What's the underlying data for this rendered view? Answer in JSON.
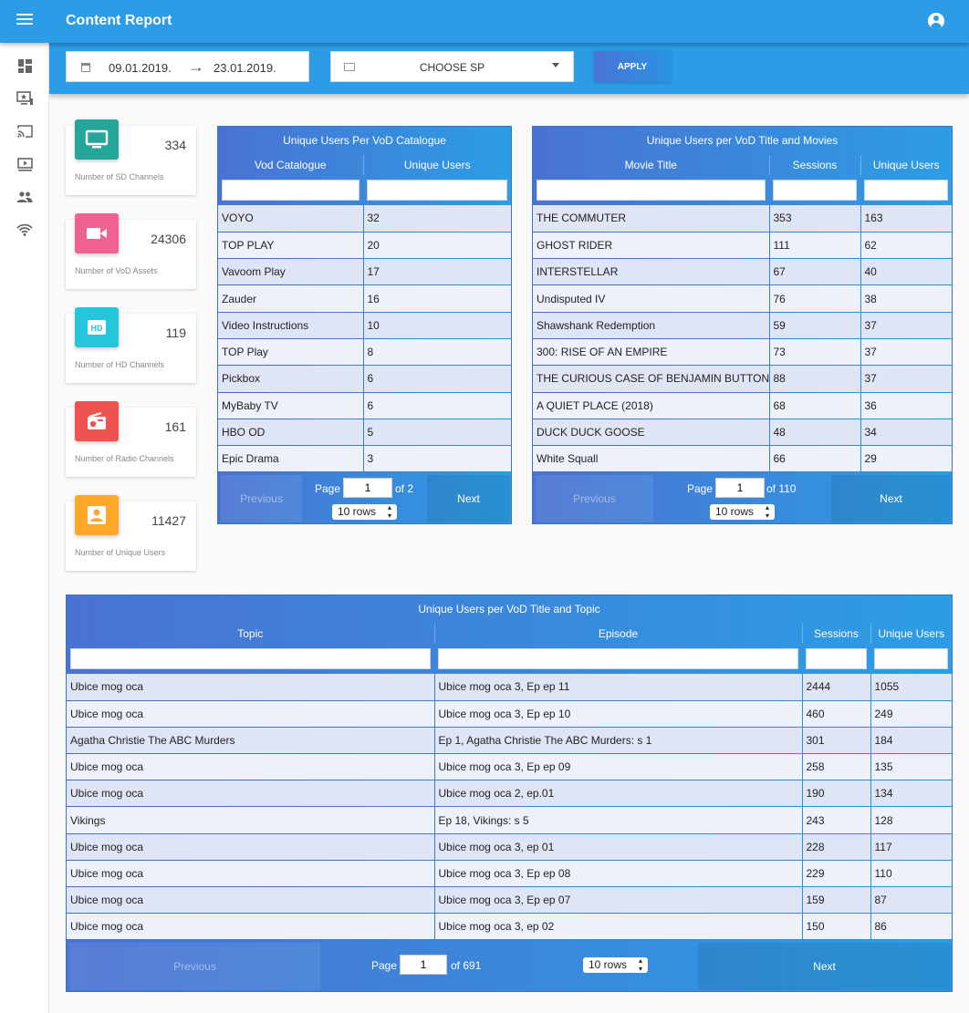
{
  "app": {
    "title": "Content Report"
  },
  "filters": {
    "date_start": "09.01.2019.",
    "date_end": "23.01.2019.",
    "arrow": "→",
    "sp_label": "CHOOSE SP",
    "apply_label": "APPLY"
  },
  "sidebar": {
    "items": [
      "dashboard-icon",
      "tv-star-icon",
      "cast-icon",
      "play-icon",
      "users-icon",
      "wifi-icon"
    ]
  },
  "stats": [
    {
      "value": "334",
      "label": "Number of SD Channels",
      "icon": "tv-icon",
      "color": "#26a69a"
    },
    {
      "value": "24306",
      "label": "Number of VoD Assets",
      "icon": "videocam-icon",
      "color": "#f06292"
    },
    {
      "value": "119",
      "label": "Number of HD Channels",
      "icon": "hd-icon",
      "color": "#26c6da"
    },
    {
      "value": "161",
      "label": "Number of Radio Channels",
      "icon": "radio-icon",
      "color": "#ef5350"
    },
    {
      "value": "11427",
      "label": "Number of Unique Users",
      "icon": "person-icon",
      "color": "#ffa726"
    }
  ],
  "catalogue": {
    "title": "Unique Users Per VoD Catalogue",
    "columns": [
      "Vod Catalogue",
      "Unique Users"
    ],
    "rows": [
      [
        "VOYO",
        "32"
      ],
      [
        "TOP PLAY",
        "20"
      ],
      [
        "Vavoom Play",
        "17"
      ],
      [
        "Zauder",
        "16"
      ],
      [
        "Video Instructions",
        "10"
      ],
      [
        "TOP Play",
        "8"
      ],
      [
        "Pickbox",
        "6"
      ],
      [
        "MyBaby TV",
        "6"
      ],
      [
        "HBO OD",
        "5"
      ],
      [
        "Epic Drama",
        "3"
      ]
    ],
    "pager": {
      "previous": "Previous",
      "next": "Next",
      "page_label": "Page",
      "page": "1",
      "of": "of 2",
      "rows": "10 rows"
    }
  },
  "movies": {
    "title": "Unique Users per VoD Title and Movies",
    "columns": [
      "Movie Title",
      "Sessions",
      "Unique Users"
    ],
    "rows": [
      [
        "THE COMMUTER",
        "353",
        "163"
      ],
      [
        "GHOST RIDER",
        "111",
        "62"
      ],
      [
        "INTERSTELLAR",
        "67",
        "40"
      ],
      [
        "Undisputed IV",
        "76",
        "38"
      ],
      [
        "Shawshank Redemption",
        "59",
        "37"
      ],
      [
        "300: RISE OF AN EMPIRE",
        "73",
        "37"
      ],
      [
        "THE CURIOUS CASE OF BENJAMIN BUTTON",
        "88",
        "37"
      ],
      [
        "A QUIET PLACE (2018)",
        "68",
        "36"
      ],
      [
        "DUCK DUCK GOOSE",
        "48",
        "34"
      ],
      [
        "White Squall",
        "66",
        "29"
      ]
    ],
    "pager": {
      "previous": "Previous",
      "next": "Next",
      "page_label": "Page",
      "page": "1",
      "of": "of 110",
      "rows": "10 rows"
    }
  },
  "topics": {
    "title": "Unique Users per VoD Title and Topic",
    "columns": [
      "Topic",
      "Episode",
      "Sessions",
      "Unique Users"
    ],
    "rows": [
      [
        "Ubice mog oca",
        "Ubice mog oca 3, Ep ep 11",
        "2444",
        "1055"
      ],
      [
        "Ubice mog oca",
        "Ubice mog oca 3, Ep ep 10",
        "460",
        "249"
      ],
      [
        "Agatha Christie The ABC Murders",
        "Ep 1, Agatha Christie The ABC Murders: s 1",
        "301",
        "184"
      ],
      [
        "Ubice mog oca",
        "Ubice mog oca 3, Ep ep 09",
        "258",
        "135"
      ],
      [
        "Ubice mog oca",
        "Ubice mog oca 2, ep.01",
        "190",
        "134"
      ],
      [
        "Vikings",
        "Ep 18, Vikings: s 5",
        "243",
        "128"
      ],
      [
        "Ubice mog oca",
        "Ubice mog oca 3, ep 01",
        "228",
        "117"
      ],
      [
        "Ubice mog oca",
        "Ubice mog oca 3, Ep ep 08",
        "229",
        "110"
      ],
      [
        "Ubice mog oca",
        "Ubice mog oca 3, Ep ep 07",
        "159",
        "87"
      ],
      [
        "Ubice mog oca",
        "Ubice mog oca 3, ep 02",
        "150",
        "86"
      ]
    ],
    "pager": {
      "previous": "Previous",
      "next": "Next",
      "page_label": "Page",
      "page": "1",
      "of": "of 691",
      "rows": "10 rows"
    }
  }
}
